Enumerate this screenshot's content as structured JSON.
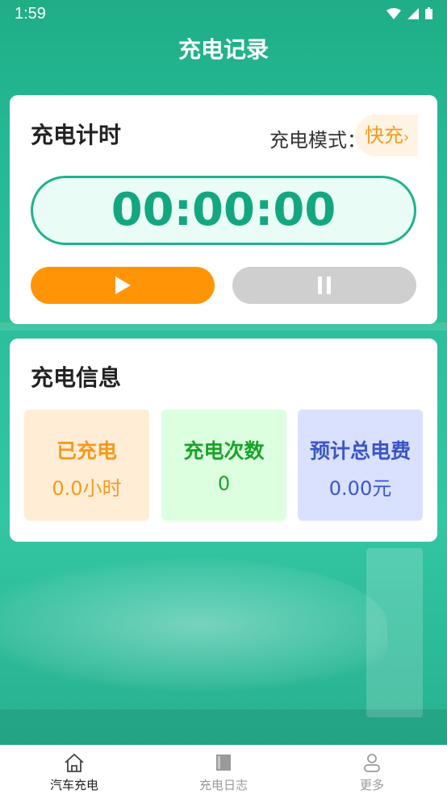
{
  "status_bar": {
    "time": "1:59"
  },
  "header": {
    "title": "充电记录"
  },
  "timer_card": {
    "title": "充电计时",
    "mode_label": "充电模式：",
    "mode_value": "快充",
    "timer": "00:00:00",
    "play_color": "#ff9506",
    "pause_color": "#cfcfcf"
  },
  "info_card": {
    "title": "充电信息",
    "boxes": [
      {
        "label": "已充电",
        "value": "0.0小时",
        "color": "#f59a1c"
      },
      {
        "label": "充电次数",
        "value": "0",
        "color": "#1aa329"
      },
      {
        "label": "预计总电费",
        "value": "0.00元",
        "color": "#3b55c6"
      }
    ]
  },
  "tabbar": {
    "items": [
      {
        "label": "汽车充电",
        "icon": "home-icon",
        "active": true
      },
      {
        "label": "充电日志",
        "icon": "book-icon",
        "active": false
      },
      {
        "label": "更多",
        "icon": "user-icon",
        "active": false
      }
    ]
  },
  "colors": {
    "accent": "#21b28b",
    "timer_bg": "#e9fcf6"
  }
}
